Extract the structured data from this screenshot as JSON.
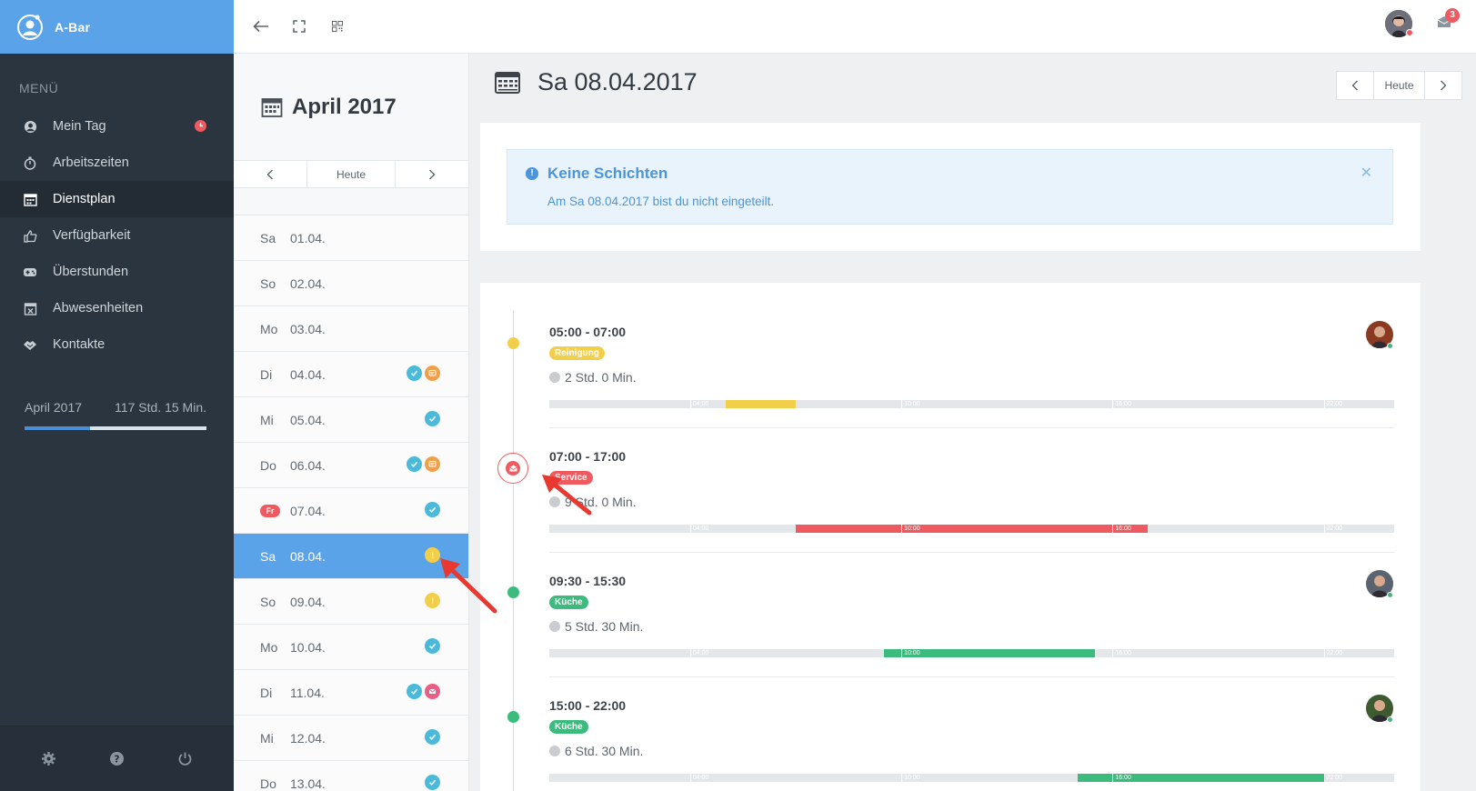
{
  "app": {
    "name": "A-Bar"
  },
  "sidebar": {
    "menu_title": "MENÜ",
    "items": [
      {
        "label": "Mein Tag",
        "icon": "user-circle-icon",
        "active": false,
        "badge": "clock"
      },
      {
        "label": "Arbeitszeiten",
        "icon": "stopwatch-icon",
        "active": false
      },
      {
        "label": "Dienstplan",
        "icon": "calendar-icon",
        "active": true
      },
      {
        "label": "Verfügbarkeit",
        "icon": "thumbs-up-icon",
        "active": false
      },
      {
        "label": "Überstunden",
        "icon": "gamepad-icon",
        "active": false
      },
      {
        "label": "Abwesenheiten",
        "icon": "calendar-x-icon",
        "active": false
      },
      {
        "label": "Kontakte",
        "icon": "handshake-icon",
        "active": false
      }
    ],
    "month_stat": {
      "month": "April 2017",
      "hours": "117 Std. 15 Min.",
      "progress": 0.36
    },
    "footer": [
      "settings-icon",
      "help-icon",
      "power-icon"
    ]
  },
  "topbar": {
    "mail_count": "3"
  },
  "daylist": {
    "month_title": "April 2017",
    "nav": {
      "today": "Heute"
    },
    "days": [
      {
        "dow": "Sa",
        "date": "01.04.",
        "icons": []
      },
      {
        "dow": "So",
        "date": "02.04.",
        "icons": []
      },
      {
        "dow": "Mo",
        "date": "03.04.",
        "icons": []
      },
      {
        "dow": "Di",
        "date": "04.04.",
        "icons": [
          "check",
          "chat"
        ]
      },
      {
        "dow": "Mi",
        "date": "05.04.",
        "icons": [
          "check"
        ]
      },
      {
        "dow": "Do",
        "date": "06.04.",
        "icons": [
          "check",
          "chat"
        ]
      },
      {
        "dow": "Fr",
        "date": "07.04.",
        "icons": [
          "check"
        ],
        "holiday": true
      },
      {
        "dow": "Sa",
        "date": "08.04.",
        "icons": [
          "warn"
        ],
        "selected": true
      },
      {
        "dow": "So",
        "date": "09.04.",
        "icons": [
          "warn"
        ]
      },
      {
        "dow": "Mo",
        "date": "10.04.",
        "icons": [
          "check"
        ]
      },
      {
        "dow": "Di",
        "date": "11.04.",
        "icons": [
          "check",
          "mail"
        ]
      },
      {
        "dow": "Mi",
        "date": "12.04.",
        "icons": [
          "check"
        ]
      },
      {
        "dow": "Do",
        "date": "13.04.",
        "icons": [
          "check"
        ]
      }
    ]
  },
  "main": {
    "day_title": "Sa 08.04.2017",
    "nav": {
      "today": "Heute"
    },
    "alert": {
      "title": "Keine Schichten",
      "text": "Am Sa 08.04.2017 bist du nicht eingeteilt."
    },
    "timeline_axis": [
      "04:00",
      "10:00",
      "16:00",
      "22:00"
    ],
    "shifts": [
      {
        "time": "05:00 - 07:00",
        "tag": "Reinigung",
        "color": "#f2cf4a",
        "duration": "2 Std. 0 Min.",
        "start": 5,
        "end": 7,
        "marker": "dot",
        "avatar": "#8a3a22"
      },
      {
        "time": "07:00 - 17:00",
        "tag": "Service",
        "color": "#ef5a60",
        "duration": "9 Std. 0 Min.",
        "start": 7,
        "end": 17,
        "marker": "mail"
      },
      {
        "time": "09:30 - 15:30",
        "tag": "Küche",
        "color": "#3dba7e",
        "duration": "5 Std. 30 Min.",
        "start": 9.5,
        "end": 15.5,
        "marker": "dot",
        "avatar": "#5a6470"
      },
      {
        "time": "15:00 - 22:00",
        "tag": "Küche",
        "color": "#3dba7e",
        "duration": "6 Std. 30 Min.",
        "start": 15,
        "end": 22,
        "marker": "dot",
        "avatar": "#3d5a30"
      }
    ]
  }
}
